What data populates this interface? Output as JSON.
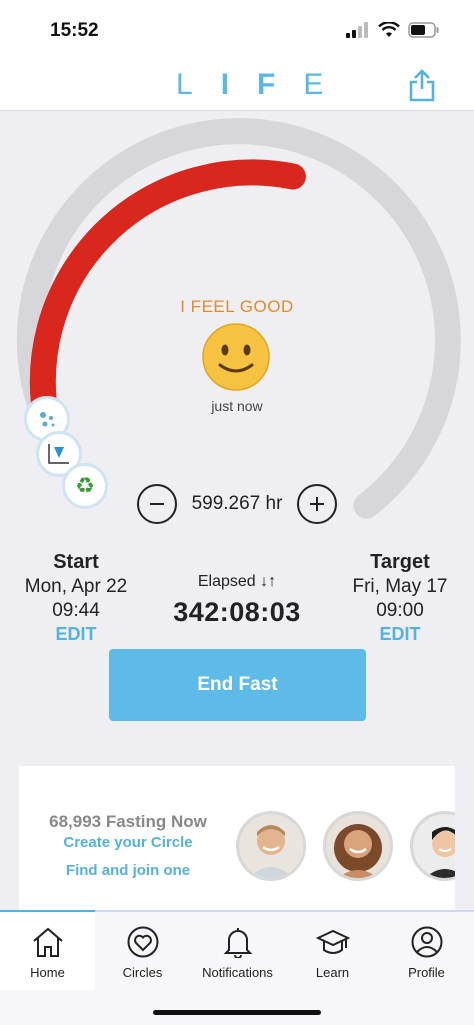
{
  "status_bar": {
    "time": "15:52"
  },
  "header": {
    "logo_letters": [
      "L",
      "I",
      "F",
      "E"
    ]
  },
  "mood": {
    "feeling": "I FEEL GOOD",
    "timestamp": "just now",
    "emoji": "slightly-smiling-face"
  },
  "fast": {
    "adjust_hours": "599.267 hr",
    "progress_fraction": 0.5,
    "start": {
      "label": "Start",
      "date": "Mon, Apr 22",
      "time": "09:44",
      "edit": "EDIT"
    },
    "elapsed": {
      "label": "Elapsed ↓↑",
      "value": "342:08:03"
    },
    "target": {
      "label": "Target",
      "date": "Fri, May 17",
      "time": "09:00",
      "edit": "EDIT"
    },
    "end_button": "End Fast"
  },
  "circles_card": {
    "count_text": "68,993 Fasting Now",
    "create_link": "Create your Circle",
    "join_link": "Find and join one"
  },
  "tabs": [
    {
      "label": "Home",
      "icon": "home-icon"
    },
    {
      "label": "Circles",
      "icon": "heart-circle-icon"
    },
    {
      "label": "Notifications",
      "icon": "bell-icon"
    },
    {
      "label": "Learn",
      "icon": "graduation-cap-icon"
    },
    {
      "label": "Profile",
      "icon": "person-circle-icon"
    }
  ],
  "colors": {
    "accent": "#5ebbe8",
    "progress": "#d9271d",
    "track": "#d7d7db",
    "mood": "#e08a2c"
  }
}
